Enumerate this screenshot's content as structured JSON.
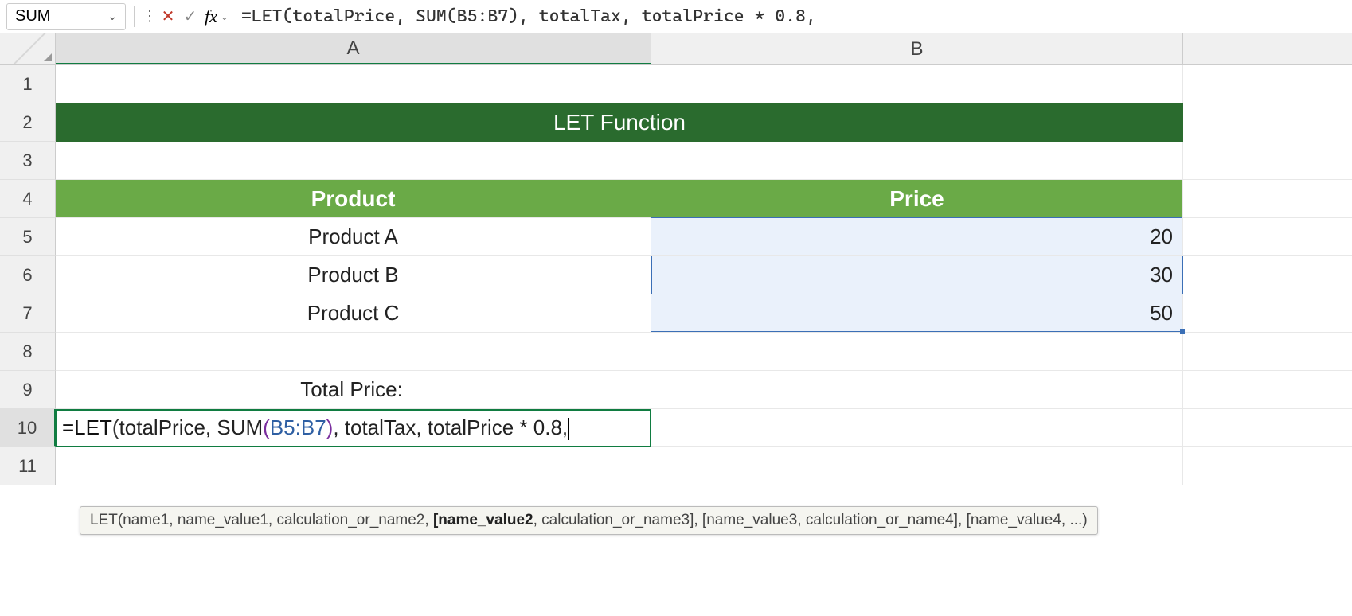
{
  "nameBox": {
    "value": "SUM"
  },
  "formulaBar": {
    "formula": "=LET(totalPrice, SUM(B5:B7), totalTax, totalPrice * 0.8,"
  },
  "columns": {
    "A": "A",
    "B": "B"
  },
  "rows": [
    "1",
    "2",
    "3",
    "4",
    "5",
    "6",
    "7",
    "8",
    "9",
    "10",
    "11"
  ],
  "title": "LET Function",
  "headers": {
    "product": "Product",
    "price": "Price"
  },
  "products": [
    {
      "name": "Product A",
      "price": "20"
    },
    {
      "name": "Product B",
      "price": "30"
    },
    {
      "name": "Product C",
      "price": "50"
    }
  ],
  "label": "Total Price:",
  "cellFormula": {
    "prefix": "=LET",
    "open1": "(",
    "seg1": "totalPrice, SUM",
    "open2": "(",
    "ref": "B5:B7",
    "close2": ")",
    "seg2": ", totalTax, totalPrice * 0.8,"
  },
  "tooltip": {
    "t1": "LET(name1, name_value1, calculation_or_name2, ",
    "current": "[name_value2",
    "t2": ", calculation_or_name3], [name_value3, calculation_or_name4], [name_value4, ...)"
  }
}
